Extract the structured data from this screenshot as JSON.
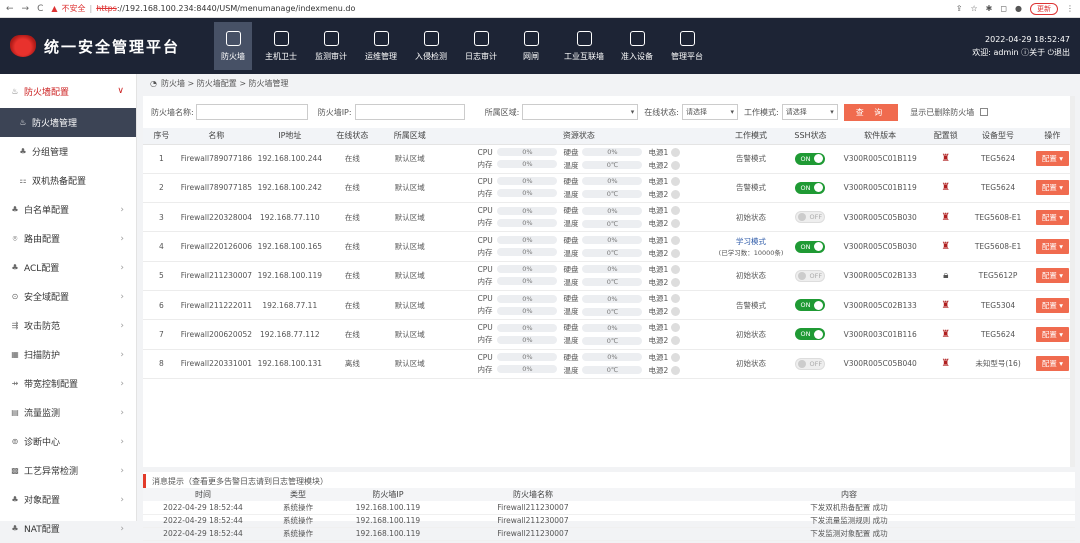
{
  "browser": {
    "insecure": "不安全",
    "https": "https",
    "url": "://192.168.100.234:8440/USM/menumanage/indexmenu.do",
    "update": "更新"
  },
  "app": {
    "title": "统一安全管理平台",
    "datetime": "2022-04-29 18:52:47",
    "welcome": "欢迎: admin",
    "about": "关于",
    "logout": "退出"
  },
  "topnav": [
    {
      "label": "防火墙",
      "icon": "firewall-icon"
    },
    {
      "label": "主机卫士",
      "icon": "host-guard-icon"
    },
    {
      "label": "监测审计",
      "icon": "eye-icon"
    },
    {
      "label": "运维管理",
      "icon": "ops-icon"
    },
    {
      "label": "入侵检测",
      "icon": "intrusion-icon"
    },
    {
      "label": "日志审计",
      "icon": "log-icon"
    },
    {
      "label": "网闸",
      "icon": "gateway-icon"
    },
    {
      "label": "工业互联墙",
      "icon": "industrial-icon"
    },
    {
      "label": "准入设备",
      "icon": "access-icon"
    },
    {
      "label": "管理平台",
      "icon": "platform-icon"
    }
  ],
  "sidebar": [
    {
      "label": "防火墙配置",
      "icon": "firewall-config-icon"
    },
    {
      "label": "防火墙管理",
      "icon": "firewall-manage-icon"
    },
    {
      "label": "分组管理",
      "icon": "group-icon"
    },
    {
      "label": "双机热备配置",
      "icon": "ha-icon"
    },
    {
      "label": "白名单配置",
      "icon": "whitelist-icon"
    },
    {
      "label": "路由配置",
      "icon": "route-icon"
    },
    {
      "label": "ACL配置",
      "icon": "acl-icon"
    },
    {
      "label": "安全域配置",
      "icon": "zone-icon"
    },
    {
      "label": "攻击防范",
      "icon": "attack-icon"
    },
    {
      "label": "扫描防护",
      "icon": "scan-icon"
    },
    {
      "label": "带宽控制配置",
      "icon": "bandwidth-icon"
    },
    {
      "label": "流量监测",
      "icon": "traffic-icon"
    },
    {
      "label": "诊断中心",
      "icon": "diagnose-icon"
    },
    {
      "label": "工艺异常检测",
      "icon": "process-icon"
    },
    {
      "label": "对象配置",
      "icon": "object-icon"
    },
    {
      "label": "NAT配置",
      "icon": "nat-icon"
    }
  ],
  "breadcrumb": "防火墙 > 防火墙配置 > 防火墙管理",
  "filter": {
    "name_label": "防火墙名称:",
    "ip_label": "防火墙IP:",
    "zone_label": "所属区域:",
    "online_label": "在线状态:",
    "online_value": "请选择",
    "mode_label": "工作模式:",
    "mode_value": "请选择",
    "query": "查 询",
    "show_deleted": "显示已删除防火墙"
  },
  "columns": [
    "序号",
    "名称",
    "IP地址",
    "在线状态",
    "所属区域",
    "资源状态",
    "工作模式",
    "SSH状态",
    "软件版本",
    "配置锁",
    "设备型号",
    "操作"
  ],
  "res_labels": {
    "cpu": "CPU",
    "mem": "内存",
    "disk": "硬盘",
    "temp": "温度",
    "p1": "电源1",
    "p2": "电源2"
  },
  "config_btn": "配置 ▾",
  "rows": [
    {
      "no": "1",
      "name": "Firewall789077186",
      "ip": "192.168.100.244",
      "status": "在线",
      "zone": "默认区域",
      "cpu": "0%",
      "mem": "0%",
      "disk": "0%",
      "temp": "0℃",
      "mode": "告警模式",
      "ssh": "ON",
      "ver": "V300R005C01B119",
      "lock": "red",
      "model": "TEG5624"
    },
    {
      "no": "2",
      "name": "Firewall789077185",
      "ip": "192.168.100.242",
      "status": "在线",
      "zone": "默认区域",
      "cpu": "0%",
      "mem": "0%",
      "disk": "0%",
      "temp": "0℃",
      "mode": "告警模式",
      "ssh": "ON",
      "ver": "V300R005C01B119",
      "lock": "red",
      "model": "TEG5624"
    },
    {
      "no": "3",
      "name": "Firewall220328004",
      "ip": "192.168.77.110",
      "status": "在线",
      "zone": "默认区域",
      "cpu": "0%",
      "mem": "0%",
      "disk": "0%",
      "temp": "0℃",
      "mode": "初始状态",
      "ssh": "OFF",
      "ver": "V300R005C05B030",
      "lock": "red",
      "model": "TEG5608-E1"
    },
    {
      "no": "4",
      "name": "Firewall220126006",
      "ip": "192.168.100.165",
      "status": "在线",
      "zone": "默认区域",
      "cpu": "0%",
      "mem": "0%",
      "disk": "0%",
      "temp": "0℃",
      "mode": "学习模式",
      "mode_sub": "(已学习数：10000条)",
      "ssh": "ON",
      "ver": "V300R005C05B030",
      "lock": "red",
      "model": "TEG5608-E1"
    },
    {
      "no": "5",
      "name": "Firewall211230007",
      "ip": "192.168.100.119",
      "status": "在线",
      "zone": "默认区域",
      "cpu": "0%",
      "mem": "0%",
      "disk": "0%",
      "temp": "0℃",
      "mode": "初始状态",
      "ssh": "OFF",
      "ver": "V300R005C02B133",
      "lock": "grey",
      "model": "TEG5612P"
    },
    {
      "no": "6",
      "name": "Firewall211222011",
      "ip": "192.168.77.11",
      "status": "在线",
      "zone": "默认区域",
      "cpu": "0%",
      "mem": "0%",
      "disk": "0%",
      "temp": "0℃",
      "mode": "告警模式",
      "ssh": "ON",
      "ver": "V300R005C02B133",
      "lock": "red",
      "model": "TEG5304"
    },
    {
      "no": "7",
      "name": "Firewall200620052",
      "ip": "192.168.77.112",
      "status": "在线",
      "zone": "默认区域",
      "cpu": "0%",
      "mem": "0%",
      "disk": "0%",
      "temp": "0℃",
      "mode": "初始状态",
      "ssh": "ON",
      "ver": "V300R003C01B116",
      "lock": "red",
      "model": "TEG5624"
    },
    {
      "no": "8",
      "name": "Firewall220331001",
      "ip": "192.168.100.131",
      "status": "离线",
      "zone": "默认区域",
      "cpu": "0%",
      "mem": "0%",
      "disk": "0%",
      "temp": "0℃",
      "mode": "初始状态",
      "ssh": "OFF",
      "ver": "V300R005C05B040",
      "lock": "red",
      "model": "未知型号(16)"
    }
  ],
  "msg": {
    "title": "消息提示（查看更多告警日志请到日志管理模块）",
    "columns": [
      "时间",
      "类型",
      "防火墙IP",
      "防火墙名称",
      "内容"
    ],
    "rows": [
      [
        "2022-04-29 18:52:44",
        "系统操作",
        "192.168.100.119",
        "Firewall211230007",
        "下发双机热备配置 成功"
      ],
      [
        "2022-04-29 18:52:44",
        "系统操作",
        "192.168.100.119",
        "Firewall211230007",
        "下发流量监测规则 成功"
      ],
      [
        "2022-04-29 18:52:44",
        "系统操作",
        "192.168.100.119",
        "Firewall211230007",
        "下发监测对象配置 成功"
      ]
    ]
  }
}
